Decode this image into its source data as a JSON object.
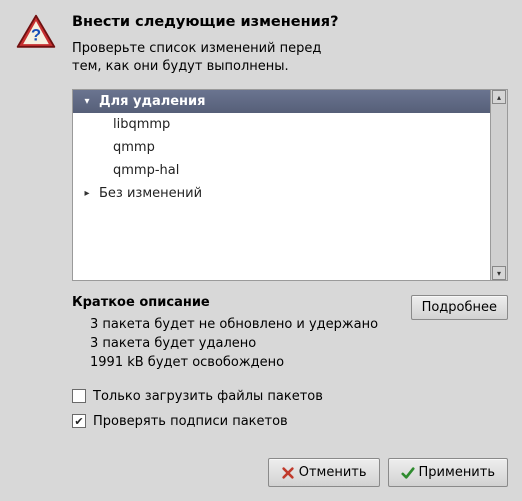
{
  "header": {
    "title": "Внести следующие изменения?",
    "subtitle_l1": "Проверьте список изменений перед",
    "subtitle_l2": "тем, как они будут выполнены."
  },
  "tree": {
    "group_remove": "Для удаления",
    "items": [
      "libqmmp",
      "qmmp",
      "qmmp-hal"
    ],
    "group_unchanged": "Без изменений"
  },
  "summary": {
    "title": "Краткое описание",
    "line1": "3 пакета будет не обновлено и удержано",
    "line2": "3 пакета будет удалено",
    "line3": "1991 kB будет освобождено"
  },
  "details_button": "Подробнее",
  "options": {
    "download_only": "Только загрузить файлы пакетов",
    "verify_sigs": "Проверять подписи пакетов"
  },
  "buttons": {
    "cancel": "Отменить",
    "apply": "Применить"
  }
}
